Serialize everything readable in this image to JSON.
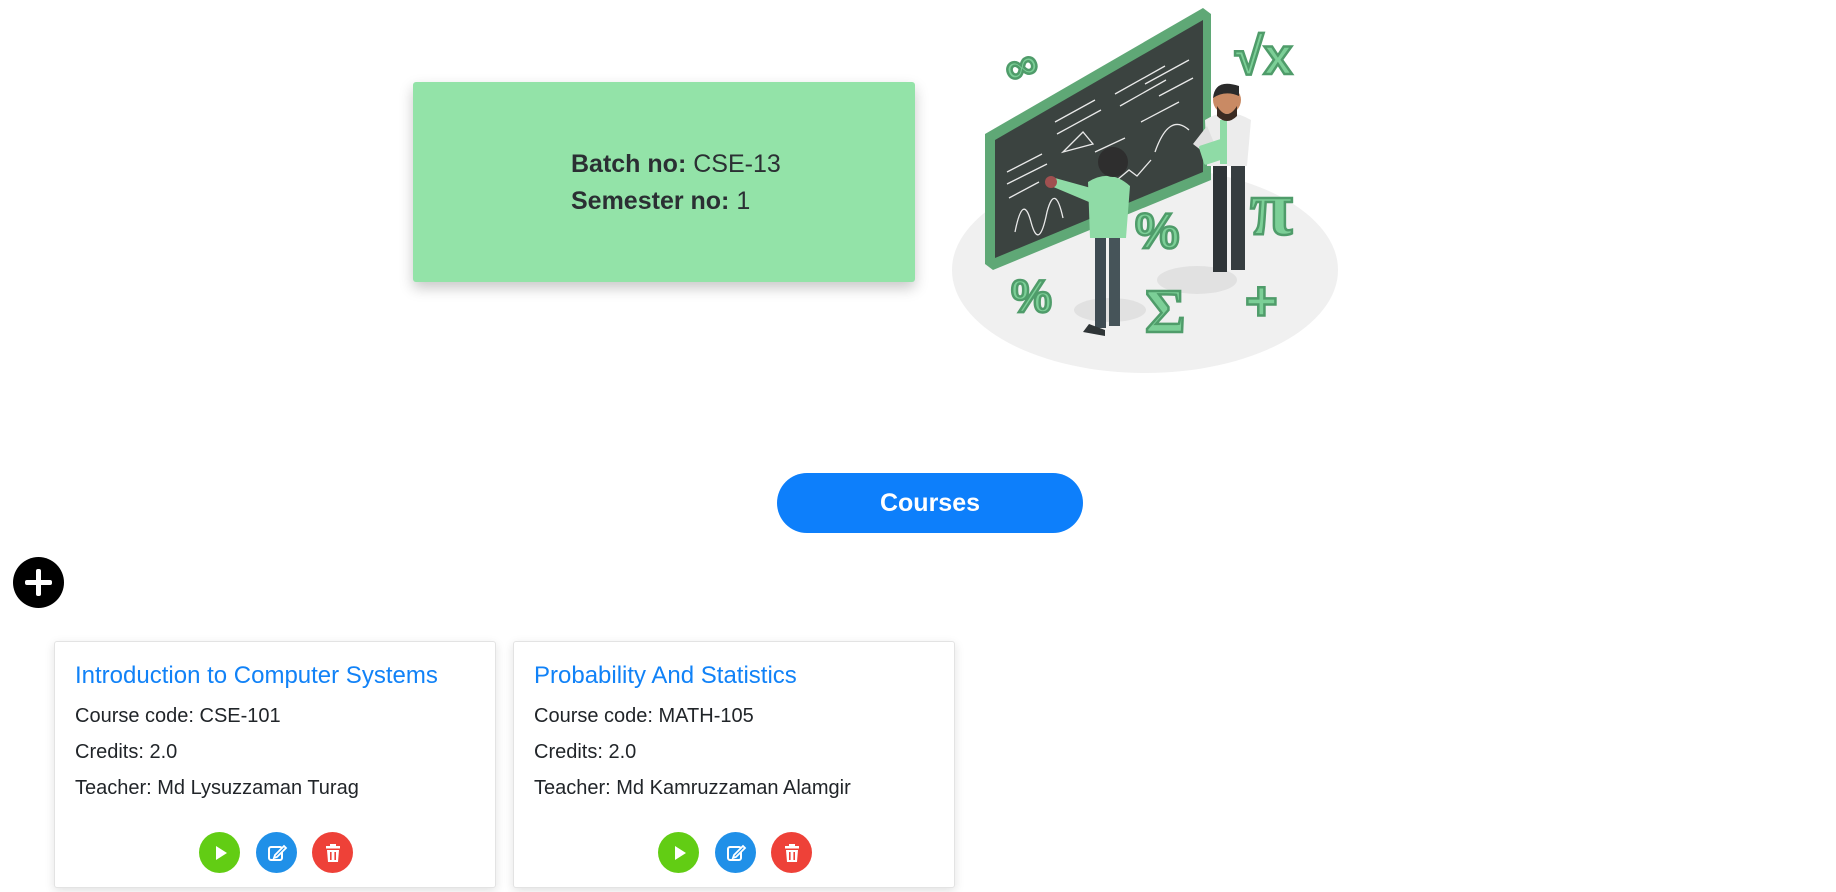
{
  "batch_info": {
    "batch_label": "Batch no:",
    "batch_value": "CSE-13",
    "semester_label": "Semester no:",
    "semester_value": "1"
  },
  "illustration": {
    "icon": "teachers-at-chalkboard-illustration",
    "accent": "#7ccf97"
  },
  "courses_button": {
    "label": "Courses",
    "color": "#0d7ffb"
  },
  "add_button": {
    "icon": "plus-circle-icon"
  },
  "courses": [
    {
      "title": "Introduction to Computer Systems",
      "code": "Course code: CSE-101",
      "credits": "Credits: 2.0",
      "teacher": "Teacher: Md Lysuzzaman Turag"
    },
    {
      "title": "Probability And Statistics",
      "code": "Course code: MATH-105",
      "credits": "Credits: 2.0",
      "teacher": "Teacher: Md Kamruzzaman Alamgir"
    }
  ],
  "course_actions": {
    "play_icon": "play-icon",
    "play_color": "#62cd14",
    "edit_icon": "edit-icon",
    "edit_color": "#2090e8",
    "delete_icon": "trash-icon",
    "delete_color": "#ee4138"
  }
}
